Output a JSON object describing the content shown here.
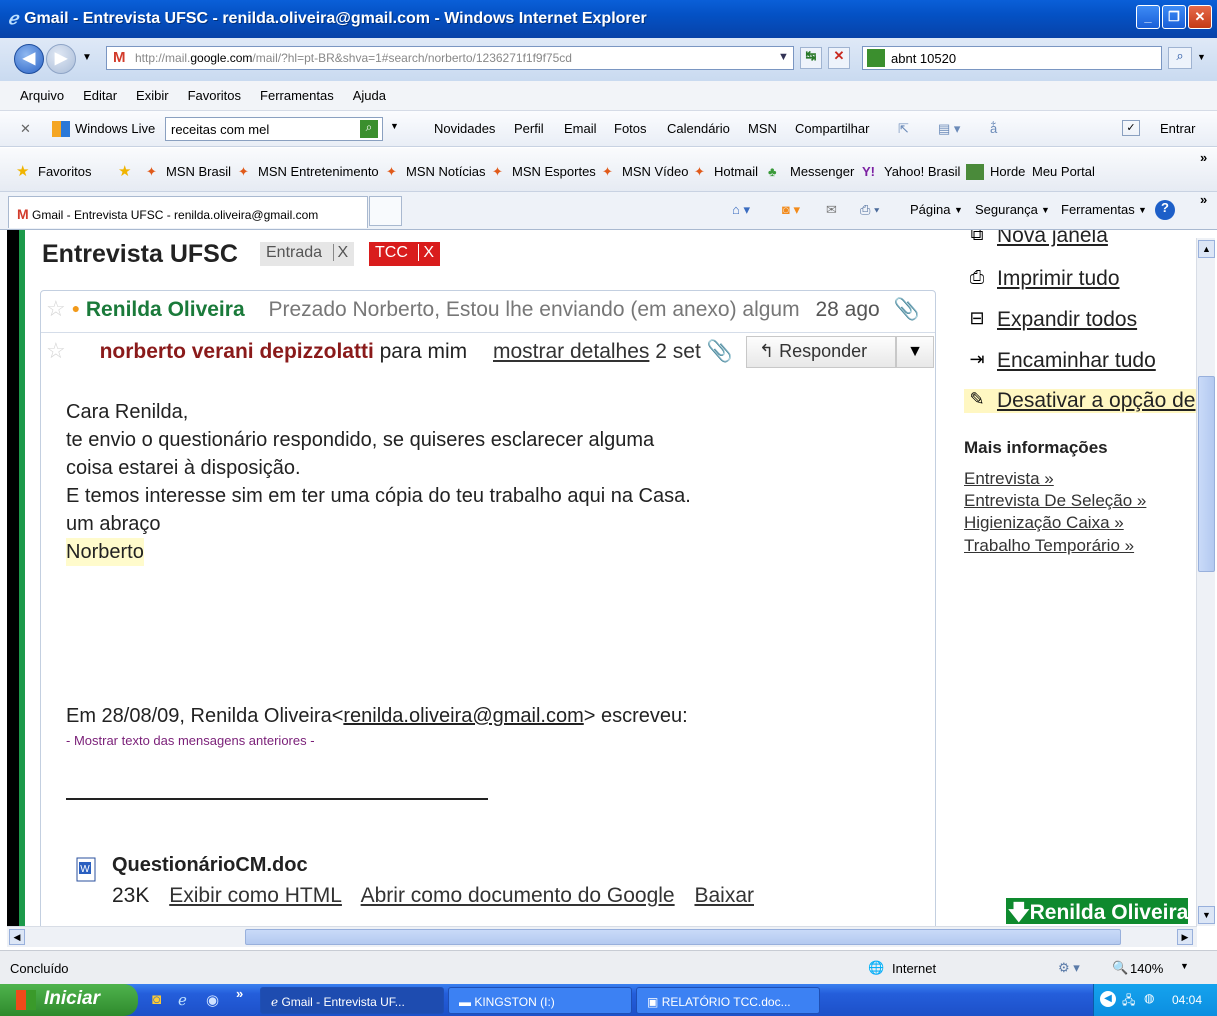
{
  "window": {
    "title": "Gmail - Entrevista UFSC - renilda.oliveira@gmail.com - Windows Internet Explorer"
  },
  "address": {
    "url_prefix": "http://mail.",
    "url_domain": "google.com",
    "url_rest": "/mail/?hl=pt-BR&shva=1#search/norberto/1236271f1f9f75cd",
    "search_value": "abnt 10520"
  },
  "menu": [
    "Arquivo",
    "Editar",
    "Exibir",
    "Favoritos",
    "Ferramentas",
    "Ajuda"
  ],
  "windows_live": {
    "brand": "Windows Live",
    "search_value": "receitas com mel",
    "links": [
      "Novidades",
      "Perfil",
      "Email",
      "Fotos",
      "Calendário",
      "MSN",
      "Compartilhar"
    ],
    "signin": "Entrar"
  },
  "favorites": {
    "label": "Favoritos",
    "items": [
      "MSN Brasil",
      "MSN Entretenimento",
      "MSN Notícias",
      "MSN Esportes",
      "MSN Vídeo",
      "Hotmail",
      "Messenger",
      "Yahoo! Brasil",
      "Horde",
      "Meu Portal"
    ]
  },
  "tab": {
    "title": "Gmail - Entrevista UFSC - renilda.oliveira@gmail.com",
    "tools": [
      "Página",
      "Segurança",
      "Ferramentas"
    ]
  },
  "email": {
    "subject": "Entrevista UFSC",
    "labels": [
      {
        "name": "Entrada",
        "x": "X"
      },
      {
        "name": "TCC",
        "x": "X"
      }
    ],
    "first_message": {
      "sender": "Renilda Oliveira",
      "snippet": "Prezado Norberto, Estou lhe enviando (em anexo) algum",
      "date": "28 ago"
    },
    "second_message": {
      "sender": "norberto verani depizzolatti",
      "to": "para mim",
      "details_link": "mostrar detalhes",
      "date": "2 set",
      "reply_label": "Responder"
    },
    "body_lines": [
      "Cara Renilda,",
      "te envio o questionário respondido, se quiseres esclarecer alguma",
      "coisa estarei à disposição.",
      "E temos interesse sim em ter uma cópia do teu trabalho aqui na Casa.",
      "um abraço"
    ],
    "signature": "Norberto",
    "quote_prefix": "Em 28/08/09, Renilda Oliveira<",
    "quote_email": "renilda.oliveira@gmail.com",
    "quote_suffix": "> escreveu:",
    "show_quoted": "- Mostrar texto das mensagens anteriores -",
    "attachment": {
      "filename": "QuestionárioCM.doc",
      "size": "23K",
      "links": [
        "Exibir como HTML",
        "Abrir como documento do Google",
        "Baixar"
      ]
    }
  },
  "sidebar": {
    "actions": [
      "Nova janela",
      "Imprimir tudo",
      "Expandir todos",
      "Encaminhar tudo",
      "Desativar a opção de"
    ],
    "more_title": "Mais informações",
    "more_links": [
      "Entrevista »",
      "Entrevista De Seleção »",
      "Higienização Caixa »",
      "Trabalho Temporário »"
    ],
    "contact_button": "Renilda Oliveira"
  },
  "status": {
    "text": "Concluído",
    "zone": "Internet",
    "zoom": "140%"
  },
  "taskbar": {
    "start": "Iniciar",
    "tasks": [
      "Gmail - Entrevista UF...",
      "KINGSTON (I:)",
      "RELATÓRIO TCC.doc..."
    ],
    "clock": "04:04"
  }
}
